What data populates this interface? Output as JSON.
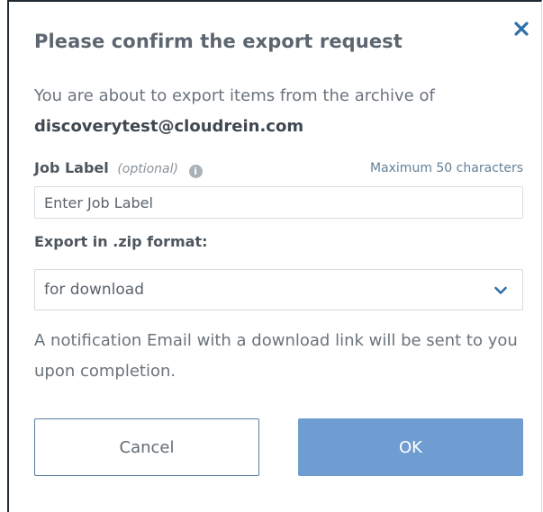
{
  "dialog": {
    "title": "Please confirm the export request",
    "intro_text": "You are about to export items from the archive of",
    "account_email": "discoverytest@cloudrein.com",
    "job_label": {
      "label": "Job Label",
      "optional_hint": "(optional)",
      "info_icon": "info-icon",
      "max_hint": "Maximum 50 characters",
      "value": "",
      "placeholder": "Enter Job Label"
    },
    "export_format": {
      "label": "Export in .zip format:",
      "selected": "for download",
      "icon": "chevron-down-icon"
    },
    "notice": "A notification Email with a download link will be sent to you upon completion.",
    "buttons": {
      "cancel_label": "Cancel",
      "ok_label": "OK"
    },
    "close_icon": "close-icon"
  },
  "colors": {
    "accent": "#2f6fa8",
    "ok_button": "#6f9dd1",
    "cancel_border": "#5b7fa1",
    "title_text": "#5d6670",
    "body_text": "#6b737b"
  }
}
